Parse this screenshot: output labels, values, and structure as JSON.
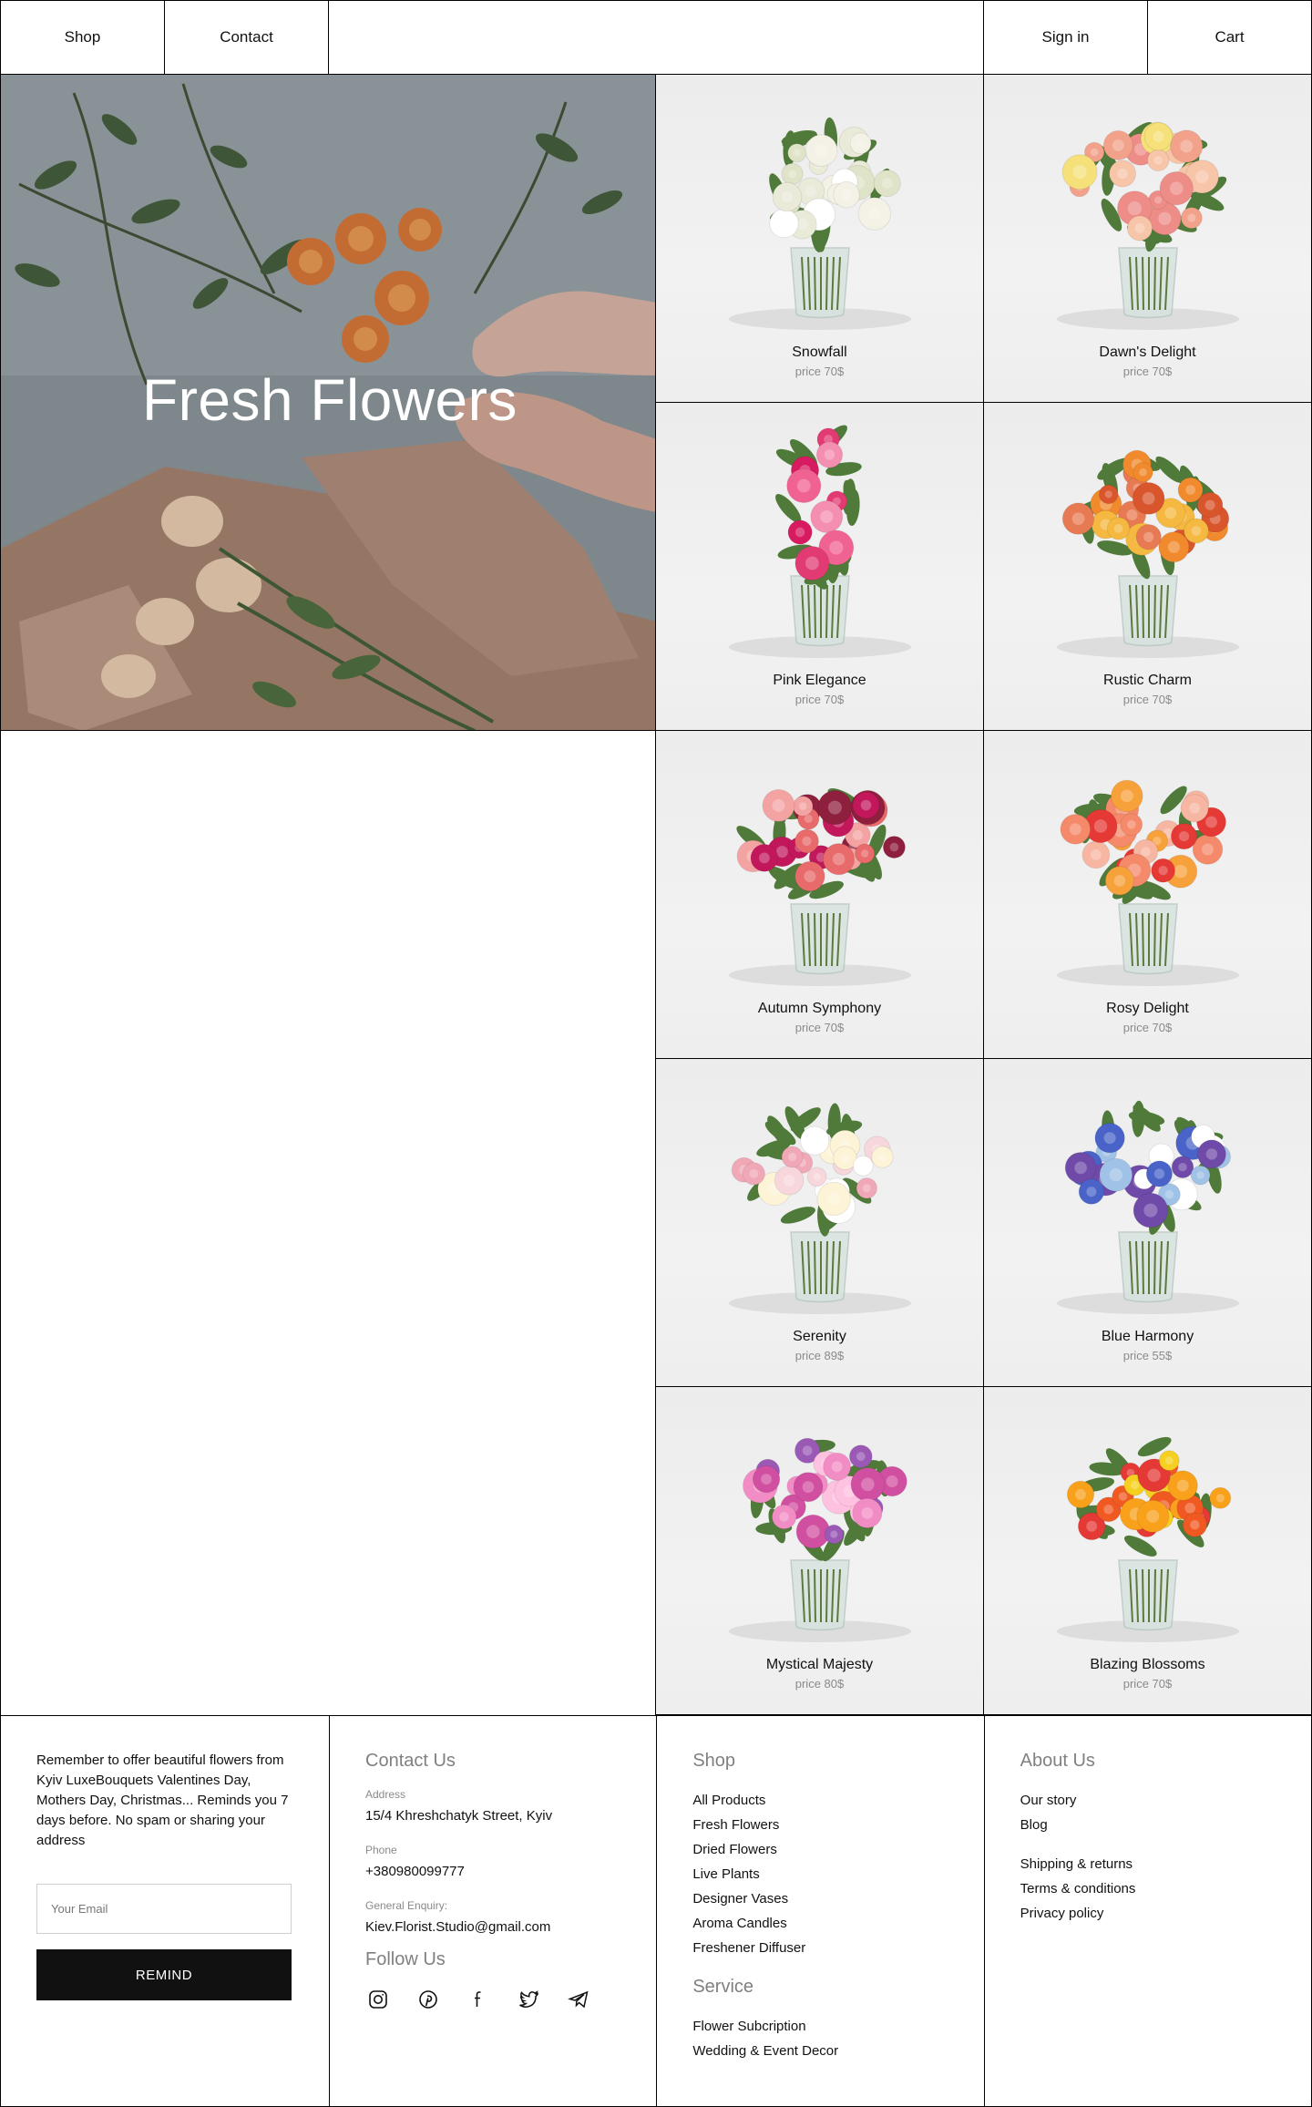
{
  "nav": {
    "shop": "Shop",
    "contact": "Contact",
    "sign_in": "Sign in",
    "cart": "Cart"
  },
  "hero": {
    "title": "Fresh Flowers"
  },
  "products": [
    {
      "name": "Snowfall",
      "price": "price 70$",
      "palette": [
        "#f4f1e6",
        "#e9ead8",
        "#ffffff",
        "#dfe3c7"
      ]
    },
    {
      "name": "Dawn's Delight",
      "price": "price 70$",
      "palette": [
        "#f2a28a",
        "#f7c5a8",
        "#ee8c88",
        "#f5e07a"
      ]
    },
    {
      "name": "Pink Elegance",
      "price": "price 70$",
      "palette": [
        "#e23b73",
        "#f48fb1",
        "#d81b60",
        "#f06292"
      ]
    },
    {
      "name": "Rustic Charm",
      "price": "price 70$",
      "palette": [
        "#f08a2c",
        "#f5b840",
        "#d9552b",
        "#e87a53"
      ]
    },
    {
      "name": "Autumn Symphony",
      "price": "price 70$",
      "palette": [
        "#c2185b",
        "#e86a6a",
        "#8e1f3d",
        "#f4a3a3"
      ]
    },
    {
      "name": "Rosy Delight",
      "price": "price 70$",
      "palette": [
        "#e53935",
        "#f48a6a",
        "#f7b6a1",
        "#f7a13a"
      ]
    },
    {
      "name": "Serenity",
      "price": "price 89$",
      "palette": [
        "#f7d7dc",
        "#fdf3d6",
        "#f0a8b6",
        "#ffffff"
      ]
    },
    {
      "name": "Blue Harmony",
      "price": "price 55$",
      "palette": [
        "#4a63c9",
        "#6f4aa8",
        "#ffffff",
        "#9fc2e6"
      ]
    },
    {
      "name": "Mystical Majesty",
      "price": "price 80$",
      "palette": [
        "#d14fa0",
        "#f28cc5",
        "#9b59b6",
        "#ffc1e0"
      ]
    },
    {
      "name": "Blazing Blossoms",
      "price": "price 70$",
      "palette": [
        "#f05a22",
        "#f9a11b",
        "#e53935",
        "#f5d020"
      ]
    }
  ],
  "footer": {
    "remind_text": "Remember to offer beautiful flowers from Kyiv LuxeBouquets Valentines Day, Mothers Day, Christmas... Reminds you 7 days before. No spam or sharing your address",
    "email_placeholder": "Your Email",
    "remind_button": "REMIND",
    "contact_heading": "Contact Us",
    "address_label": "Address",
    "address": "15/4 Khreshchatyk Street, Kyiv",
    "phone_label": "Phone",
    "phone": "+380980099777",
    "enquiry_label": "General Enquiry:",
    "email": "Kiev.Florist.Studio@gmail.com",
    "follow_heading": "Follow Us",
    "socials": [
      "instagram-icon",
      "pinterest-icon",
      "facebook-icon",
      "twitter-icon",
      "telegram-icon"
    ],
    "shop_heading": "Shop",
    "shop_links": [
      "All Products",
      "Fresh Flowers",
      "Dried Flowers",
      "Live Plants",
      "Designer Vases",
      "Aroma Candles",
      "Freshener Diffuser"
    ],
    "service_heading": "Service",
    "service_links": [
      "Flower Subcription",
      "Wedding & Event Decor"
    ],
    "about_heading": "About Us",
    "about_links": [
      "Our story",
      "Blog"
    ],
    "policy_links": [
      "Shipping & returns",
      "Terms & conditions",
      "Privacy policy"
    ]
  }
}
